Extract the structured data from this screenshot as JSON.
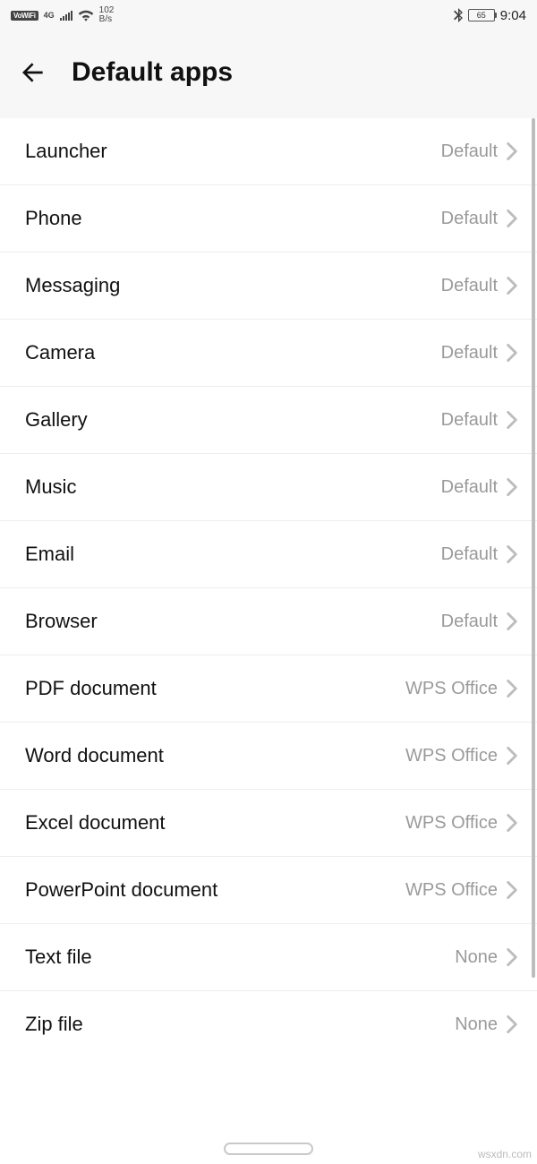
{
  "status": {
    "vowifi": "VoWiFi",
    "net_gen": "4G",
    "speed_value": "102",
    "speed_unit": "B/s",
    "battery": "65",
    "time": "9:04"
  },
  "header": {
    "title": "Default apps"
  },
  "rows": [
    {
      "label": "Launcher",
      "value": "Default"
    },
    {
      "label": "Phone",
      "value": "Default"
    },
    {
      "label": "Messaging",
      "value": "Default"
    },
    {
      "label": "Camera",
      "value": "Default"
    },
    {
      "label": "Gallery",
      "value": "Default"
    },
    {
      "label": "Music",
      "value": "Default"
    },
    {
      "label": "Email",
      "value": "Default"
    },
    {
      "label": "Browser",
      "value": "Default"
    },
    {
      "label": "PDF document",
      "value": "WPS Office"
    },
    {
      "label": "Word document",
      "value": "WPS Office"
    },
    {
      "label": "Excel document",
      "value": "WPS Office"
    },
    {
      "label": "PowerPoint document",
      "value": "WPS Office"
    },
    {
      "label": "Text file",
      "value": "None"
    },
    {
      "label": "Zip file",
      "value": "None"
    }
  ],
  "watermark": "wsxdn.com"
}
